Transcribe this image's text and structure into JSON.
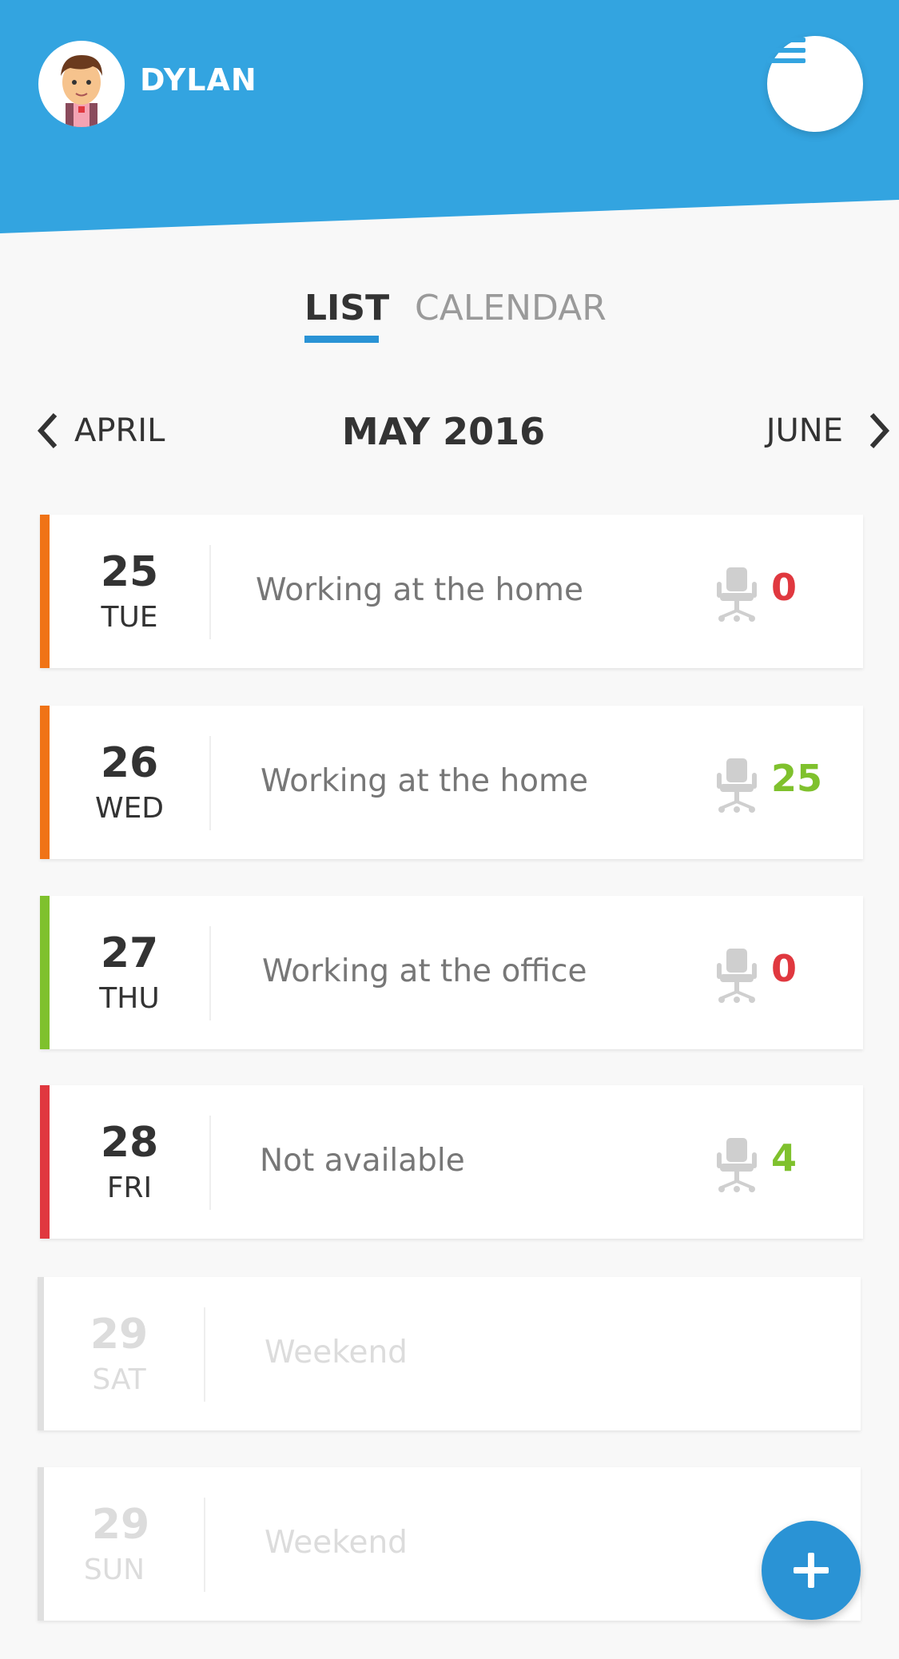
{
  "header": {
    "username": "DYLAN",
    "bg_color": "#33a4e0",
    "menu_icon": "hamburger-icon"
  },
  "tabs": [
    {
      "label": "LIST",
      "active": true
    },
    {
      "label": "CALENDAR",
      "active": false
    }
  ],
  "month_nav": {
    "prev_label": "APRIL",
    "current_label": "MAY 2016",
    "next_label": "JUNE"
  },
  "days": [
    {
      "num": "25",
      "dow": "TUE",
      "desc": "Working at the home",
      "count": "0",
      "status_color": "#f07316",
      "count_color": "#e0383f"
    },
    {
      "num": "26",
      "dow": "WED",
      "desc": "Working at the home",
      "count": "25",
      "status_color": "#f07316",
      "count_color": "#7fc12d"
    },
    {
      "num": "27",
      "dow": "THU",
      "desc": "Working at the office",
      "count": "0",
      "status_color": "#7fc12d",
      "count_color": "#e0383f"
    },
    {
      "num": "28",
      "dow": "FRI",
      "desc": "Not available",
      "count": "4",
      "status_color": "#e0383f",
      "count_color": "#7fc12d"
    },
    {
      "num": "29",
      "dow": "SAT",
      "desc": "Weekend",
      "status_color": "#e0e0e0"
    },
    {
      "num": "29",
      "dow": "SUN",
      "desc": "Weekend",
      "status_color": "#e0e0e0"
    }
  ],
  "fab": {
    "icon": "plus-icon",
    "color": "#2a93d5"
  }
}
